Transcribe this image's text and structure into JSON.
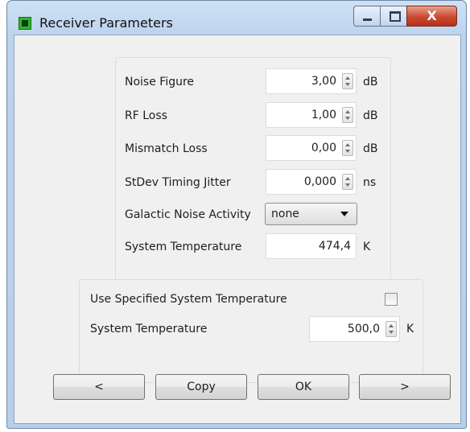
{
  "window": {
    "title": "Receiver Parameters",
    "close_glyph": "X"
  },
  "params": {
    "noise_figure": {
      "label": "Noise Figure",
      "value": "3,00",
      "unit": "dB"
    },
    "rf_loss": {
      "label": "RF Loss",
      "value": "1,00",
      "unit": "dB"
    },
    "mismatch_loss": {
      "label": "Mismatch Loss",
      "value": "0,00",
      "unit": "dB"
    },
    "timing_jitter": {
      "label": "StDev Timing Jitter",
      "value": "0,000",
      "unit": "ns"
    },
    "galactic_noise": {
      "label": "Galactic Noise Activity",
      "selected": "none"
    },
    "system_temperature": {
      "label": "System Temperature",
      "value": "474,4",
      "unit": "K"
    }
  },
  "specified": {
    "use_label": "Use Specified System Temperature",
    "checked": false,
    "temp_label": "System Temperature",
    "temp_value": "500,0",
    "temp_unit": "K"
  },
  "buttons": {
    "prev": "<",
    "copy": "Copy",
    "ok": "OK",
    "next": ">"
  }
}
